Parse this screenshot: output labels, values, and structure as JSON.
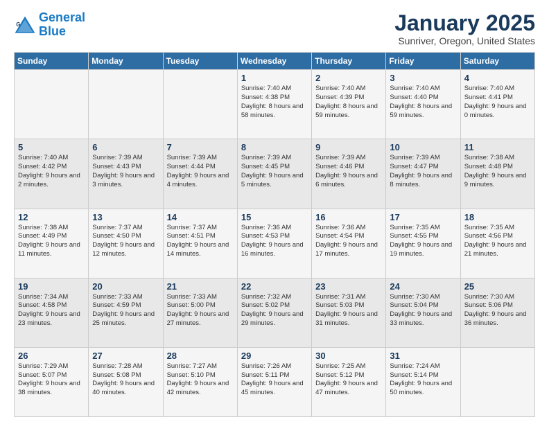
{
  "logo": {
    "line1": "General",
    "line2": "Blue"
  },
  "title": "January 2025",
  "subtitle": "Sunriver, Oregon, United States",
  "weekdays": [
    "Sunday",
    "Monday",
    "Tuesday",
    "Wednesday",
    "Thursday",
    "Friday",
    "Saturday"
  ],
  "rows": [
    [
      {
        "day": "",
        "info": ""
      },
      {
        "day": "",
        "info": ""
      },
      {
        "day": "",
        "info": ""
      },
      {
        "day": "1",
        "info": "Sunrise: 7:40 AM\nSunset: 4:38 PM\nDaylight: 8 hours and 58 minutes."
      },
      {
        "day": "2",
        "info": "Sunrise: 7:40 AM\nSunset: 4:39 PM\nDaylight: 8 hours and 59 minutes."
      },
      {
        "day": "3",
        "info": "Sunrise: 7:40 AM\nSunset: 4:40 PM\nDaylight: 8 hours and 59 minutes."
      },
      {
        "day": "4",
        "info": "Sunrise: 7:40 AM\nSunset: 4:41 PM\nDaylight: 9 hours and 0 minutes."
      }
    ],
    [
      {
        "day": "5",
        "info": "Sunrise: 7:40 AM\nSunset: 4:42 PM\nDaylight: 9 hours and 2 minutes."
      },
      {
        "day": "6",
        "info": "Sunrise: 7:39 AM\nSunset: 4:43 PM\nDaylight: 9 hours and 3 minutes."
      },
      {
        "day": "7",
        "info": "Sunrise: 7:39 AM\nSunset: 4:44 PM\nDaylight: 9 hours and 4 minutes."
      },
      {
        "day": "8",
        "info": "Sunrise: 7:39 AM\nSunset: 4:45 PM\nDaylight: 9 hours and 5 minutes."
      },
      {
        "day": "9",
        "info": "Sunrise: 7:39 AM\nSunset: 4:46 PM\nDaylight: 9 hours and 6 minutes."
      },
      {
        "day": "10",
        "info": "Sunrise: 7:39 AM\nSunset: 4:47 PM\nDaylight: 9 hours and 8 minutes."
      },
      {
        "day": "11",
        "info": "Sunrise: 7:38 AM\nSunset: 4:48 PM\nDaylight: 9 hours and 9 minutes."
      }
    ],
    [
      {
        "day": "12",
        "info": "Sunrise: 7:38 AM\nSunset: 4:49 PM\nDaylight: 9 hours and 11 minutes."
      },
      {
        "day": "13",
        "info": "Sunrise: 7:37 AM\nSunset: 4:50 PM\nDaylight: 9 hours and 12 minutes."
      },
      {
        "day": "14",
        "info": "Sunrise: 7:37 AM\nSunset: 4:51 PM\nDaylight: 9 hours and 14 minutes."
      },
      {
        "day": "15",
        "info": "Sunrise: 7:36 AM\nSunset: 4:53 PM\nDaylight: 9 hours and 16 minutes."
      },
      {
        "day": "16",
        "info": "Sunrise: 7:36 AM\nSunset: 4:54 PM\nDaylight: 9 hours and 17 minutes."
      },
      {
        "day": "17",
        "info": "Sunrise: 7:35 AM\nSunset: 4:55 PM\nDaylight: 9 hours and 19 minutes."
      },
      {
        "day": "18",
        "info": "Sunrise: 7:35 AM\nSunset: 4:56 PM\nDaylight: 9 hours and 21 minutes."
      }
    ],
    [
      {
        "day": "19",
        "info": "Sunrise: 7:34 AM\nSunset: 4:58 PM\nDaylight: 9 hours and 23 minutes."
      },
      {
        "day": "20",
        "info": "Sunrise: 7:33 AM\nSunset: 4:59 PM\nDaylight: 9 hours and 25 minutes."
      },
      {
        "day": "21",
        "info": "Sunrise: 7:33 AM\nSunset: 5:00 PM\nDaylight: 9 hours and 27 minutes."
      },
      {
        "day": "22",
        "info": "Sunrise: 7:32 AM\nSunset: 5:02 PM\nDaylight: 9 hours and 29 minutes."
      },
      {
        "day": "23",
        "info": "Sunrise: 7:31 AM\nSunset: 5:03 PM\nDaylight: 9 hours and 31 minutes."
      },
      {
        "day": "24",
        "info": "Sunrise: 7:30 AM\nSunset: 5:04 PM\nDaylight: 9 hours and 33 minutes."
      },
      {
        "day": "25",
        "info": "Sunrise: 7:30 AM\nSunset: 5:06 PM\nDaylight: 9 hours and 36 minutes."
      }
    ],
    [
      {
        "day": "26",
        "info": "Sunrise: 7:29 AM\nSunset: 5:07 PM\nDaylight: 9 hours and 38 minutes."
      },
      {
        "day": "27",
        "info": "Sunrise: 7:28 AM\nSunset: 5:08 PM\nDaylight: 9 hours and 40 minutes."
      },
      {
        "day": "28",
        "info": "Sunrise: 7:27 AM\nSunset: 5:10 PM\nDaylight: 9 hours and 42 minutes."
      },
      {
        "day": "29",
        "info": "Sunrise: 7:26 AM\nSunset: 5:11 PM\nDaylight: 9 hours and 45 minutes."
      },
      {
        "day": "30",
        "info": "Sunrise: 7:25 AM\nSunset: 5:12 PM\nDaylight: 9 hours and 47 minutes."
      },
      {
        "day": "31",
        "info": "Sunrise: 7:24 AM\nSunset: 5:14 PM\nDaylight: 9 hours and 50 minutes."
      },
      {
        "day": "",
        "info": ""
      }
    ]
  ]
}
